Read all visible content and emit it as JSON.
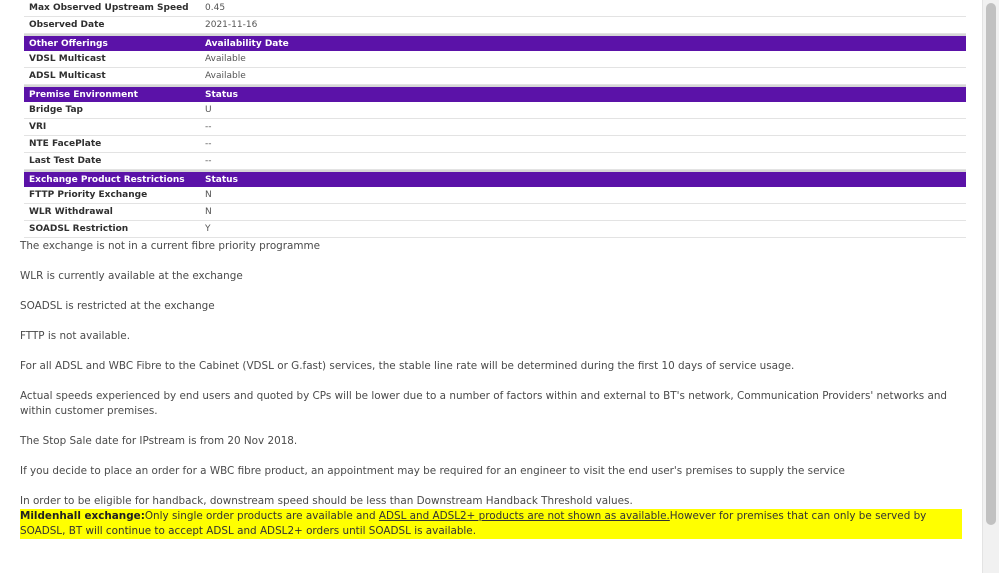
{
  "top_rows": [
    {
      "label": "Max Observed Upstream Speed",
      "value": "0.45"
    },
    {
      "label": "Observed Date",
      "value": "2021-11-16"
    }
  ],
  "sections": [
    {
      "header": [
        "Other Offerings",
        "Availability Date"
      ],
      "rows": [
        {
          "label": "VDSL Multicast",
          "value": "Available"
        },
        {
          "label": "ADSL Multicast",
          "value": "Available"
        }
      ]
    },
    {
      "header": [
        "Premise Environment",
        "Status"
      ],
      "rows": [
        {
          "label": "Bridge Tap",
          "value": "U"
        },
        {
          "label": "VRI",
          "value": "--"
        },
        {
          "label": "NTE FacePlate",
          "value": "--"
        },
        {
          "label": "Last Test Date",
          "value": "--"
        }
      ]
    },
    {
      "header": [
        "Exchange Product Restrictions",
        "Status"
      ],
      "rows": [
        {
          "label": "FTTP Priority Exchange",
          "value": "N"
        },
        {
          "label": "WLR Withdrawal",
          "value": "N"
        },
        {
          "label": "SOADSL Restriction",
          "value": "Y"
        }
      ]
    }
  ],
  "notes": [
    "The exchange is not in a current fibre priority programme",
    "WLR is currently available at the exchange",
    "SOADSL is restricted at the exchange",
    "FTTP is not available.",
    "For all ADSL and WBC Fibre to the Cabinet (VDSL or G.fast) services, the stable line rate will be determined during the first 10 days of service usage.",
    "Actual speeds experienced by end users and quoted by CPs will be lower due to a number of factors within and external to BT's network, Communication Providers' networks and within customer premises.",
    "The Stop Sale date for IPstream is from 20 Nov 2018.",
    "If you decide to place an order for a WBC fibre product, an appointment may be required for an engineer to visit the end user's premises to supply the service",
    "In order to be eligible for handback, downstream speed should be less than Downstream Handback Threshold values."
  ],
  "highlight": {
    "bold": "Mildenhall exchange:",
    "part1": "Only single order products are available and ",
    "underlined": "ADSL and ADSL2+ products are not shown as available.",
    "part2": "However for premises that can only be served by SOADSL, BT will continue to accept ADSL and ADSL2+ orders until SOADSL is available."
  }
}
